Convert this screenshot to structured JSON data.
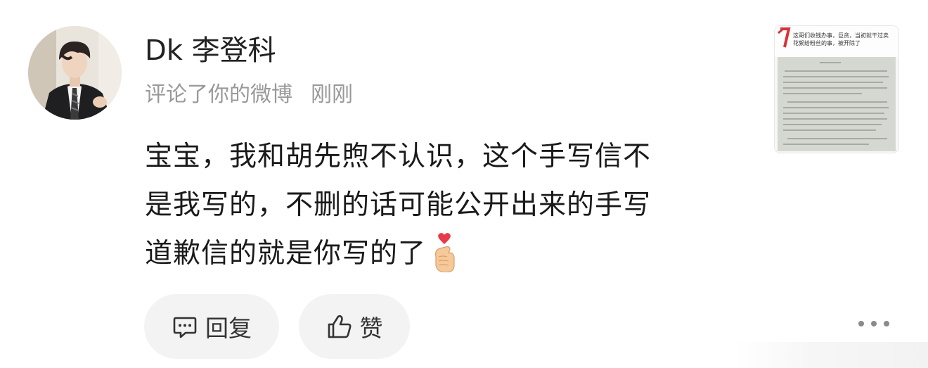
{
  "user": {
    "name": "Dk 李登科",
    "avatar_icon": "user-avatar-photo"
  },
  "meta": {
    "action": "评论了你的微博",
    "time": "刚刚"
  },
  "comment": {
    "lines": [
      "宝宝，我和胡先煦不认识，这个手写信不",
      "是我写的，不删的话可能公开出来的手写",
      "道歉信的就是你写的了"
    ],
    "emoji_icon": "finger-heart-icon"
  },
  "actions": {
    "reply_label": "回复",
    "like_label": "赞",
    "more_icon": "more-dots-icon"
  },
  "thumbnail": {
    "snippet_line1": "这哥们收钱办事，巨贪，当初就干过卖",
    "snippet_line2": "花絮给粉丝的事，被开除了"
  },
  "colors": {
    "text_primary": "#1a1a1a",
    "text_secondary": "#999999",
    "pill_bg": "#f3f3f3"
  }
}
